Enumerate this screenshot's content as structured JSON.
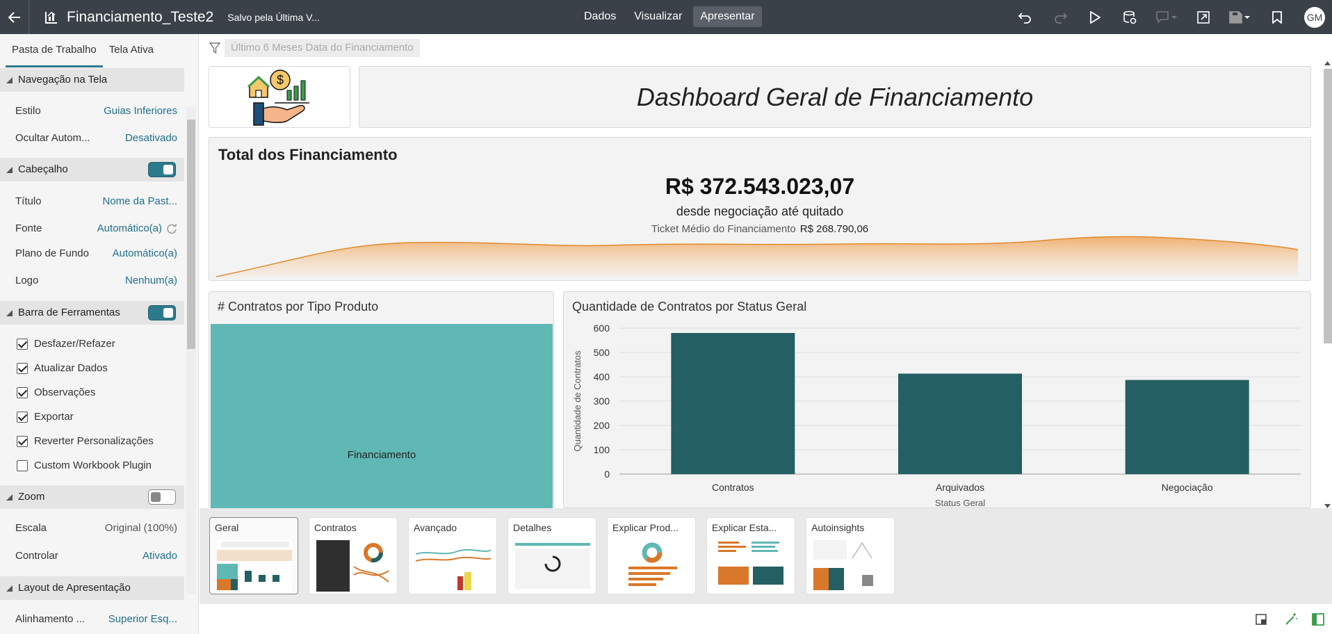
{
  "header": {
    "title": "Financiamento_Teste2",
    "saved_status": "Salvo pela Última V...",
    "nav": [
      "Dados",
      "Visualizar",
      "Apresentar"
    ],
    "avatar": "GM"
  },
  "panel": {
    "tabs": [
      "Pasta de Trabalho",
      "Tela Ativa"
    ],
    "sections": {
      "nav": "Navegação na Tela",
      "header": "Cabeçalho",
      "toolbar": "Barra de Ferramentas",
      "zoom": "Zoom",
      "layout": "Layout de Apresentação"
    },
    "props": {
      "estilo_k": "Estilo",
      "estilo_v": "Guias Inferiores",
      "ocultar_k": "Ocultar Autom...",
      "ocultar_v": "Desativado",
      "titulo_k": "Título",
      "titulo_v": "Nome da Past...",
      "fonte_k": "Fonte",
      "fonte_v": "Automático(a)",
      "fundo_k": "Plano de Fundo",
      "fundo_v": "Automático(a)",
      "logo_k": "Logo",
      "logo_v": "Nenhum(a)",
      "escala_k": "Escala",
      "escala_v": "Original (100%)",
      "controlar_k": "Controlar",
      "controlar_v": "Ativado",
      "alinhamento_k": "Alinhamento ...",
      "alinhamento_v": "Superior Esq..."
    },
    "toolbar_options": [
      {
        "label": "Desfazer/Refazer",
        "checked": true
      },
      {
        "label": "Atualizar Dados",
        "checked": true
      },
      {
        "label": "Observações",
        "checked": true
      },
      {
        "label": "Exportar",
        "checked": true
      },
      {
        "label": "Reverter Personalizações",
        "checked": true
      },
      {
        "label": "Custom Workbook Plugin",
        "checked": false
      }
    ]
  },
  "canvas": {
    "filter": "Último 6 Meses Data do Financiamento",
    "dashboard_title": "Dashboard Geral de Financiamento",
    "total": {
      "title": "Total dos Financiamento",
      "value": "R$ 372.543.023,07",
      "subtitle": "desde negociação até quitado",
      "ticket_label": "Ticket Médio do Financiamento",
      "ticket_value": "R$ 268.790,06"
    },
    "treemap": {
      "title": "# Contratos por Tipo Produto",
      "label": "Financiamento"
    },
    "bars": {
      "title": "Quantidade de Contratos por Status Geral",
      "xlabel": "Status Geral"
    }
  },
  "chart_data": {
    "type": "bar",
    "title": "Quantidade de Contratos por Status Geral",
    "ylabel": "Quantidade de Contratos",
    "xlabel": "Status Geral",
    "categories": [
      "Contratos",
      "Arquivados",
      "Negociação"
    ],
    "values": [
      580,
      413,
      387
    ],
    "ylim": [
      0,
      600
    ],
    "yticks": [
      0,
      100,
      200,
      300,
      400,
      500,
      600
    ],
    "color": "#245f63",
    "grid": true
  },
  "thumbnails": [
    "Geral",
    "Contratos",
    "Avançado",
    "Detalhes",
    "Explicar Prod...",
    "Explicar Esta...",
    "Autoinsights"
  ]
}
